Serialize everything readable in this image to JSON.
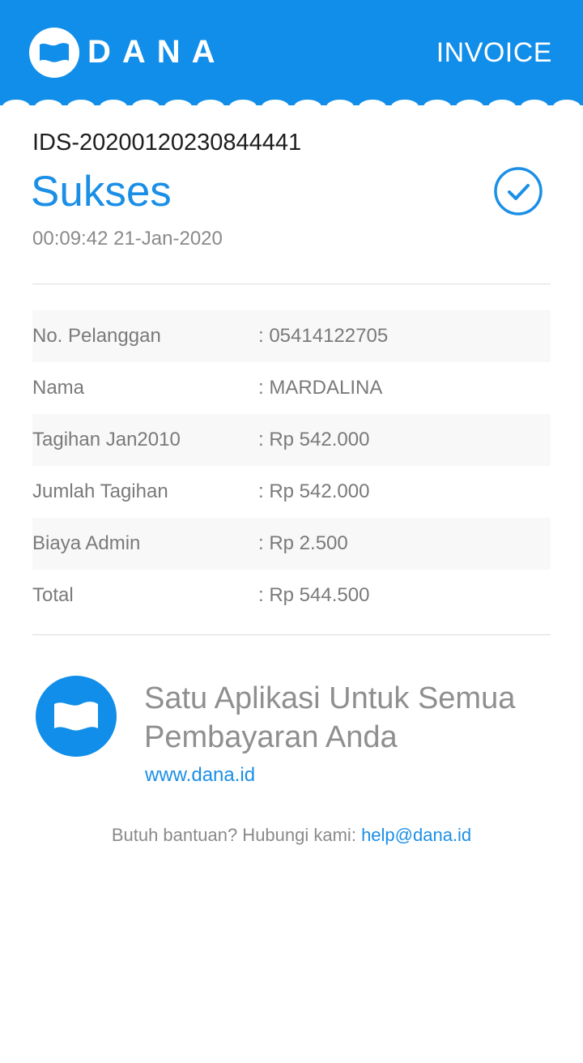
{
  "header": {
    "brand": "DANA",
    "document_type": "INVOICE",
    "logo_icon": "dana-wave-logo-icon",
    "background_color": "#118ee9"
  },
  "transaction": {
    "id": "IDS-20200120230844441",
    "status": "Sukses",
    "status_icon": "check-circle-icon",
    "datetime": "00:09:42 21-Jan-2020"
  },
  "details": [
    {
      "label": "No. Pelanggan",
      "value": ": 05414122705"
    },
    {
      "label": "Nama",
      "value": ": MARDALINA"
    },
    {
      "label": "Tagihan Jan2010",
      "value": ": Rp 542.000"
    },
    {
      "label": "Jumlah Tagihan",
      "value": ": Rp 542.000"
    },
    {
      "label": "Biaya Admin",
      "value": ": Rp 2.500"
    },
    {
      "label": "Total",
      "value": ": Rp 544.500"
    }
  ],
  "promo": {
    "tagline": "Satu Aplikasi Untuk Semua Pembayaran Anda",
    "website": "www.dana.id"
  },
  "footer": {
    "help_text": "Butuh bantuan? Hubungi kami:",
    "help_email": "help@dana.id"
  },
  "colors": {
    "accent": "#1b8fe6",
    "muted_text": "#8a8a8a"
  }
}
